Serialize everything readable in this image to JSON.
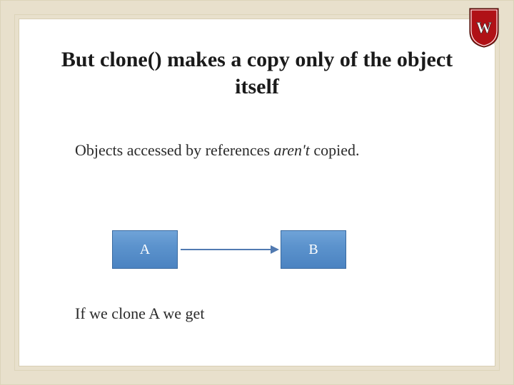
{
  "slide": {
    "title": "But clone() makes a copy only of the object itself",
    "line1_a": "Objects accessed by references ",
    "line1_b": "aren't",
    "line1_c": " copied.",
    "line2": "If we clone A we get"
  },
  "diagram": {
    "boxA": "A",
    "boxB": "B"
  },
  "logo": {
    "letter": "W"
  }
}
